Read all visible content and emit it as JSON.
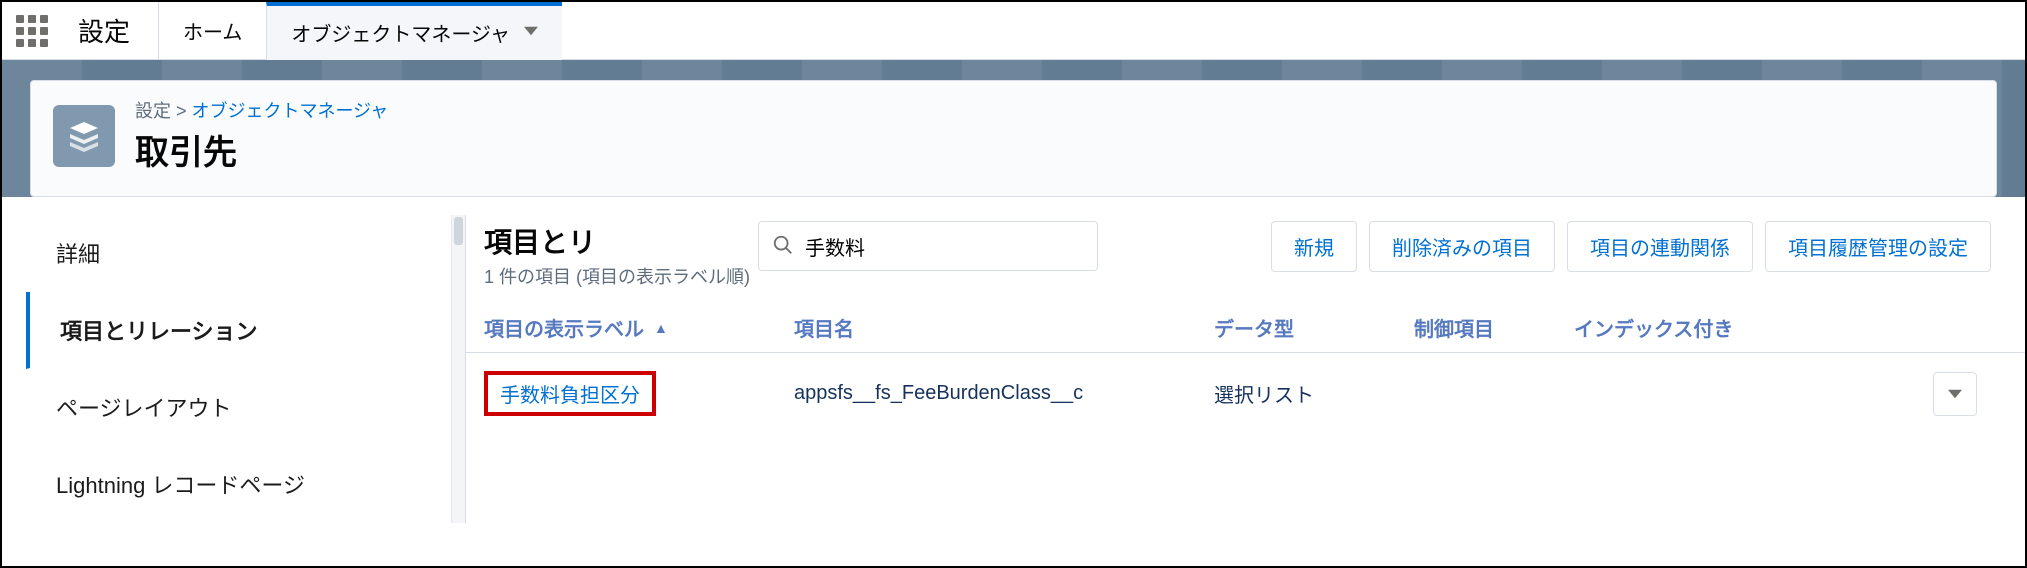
{
  "topbar": {
    "settings_label": "設定",
    "tab_home": "ホーム",
    "tab_object_manager": "オブジェクトマネージャ"
  },
  "breadcrumb": {
    "parent": "設定",
    "current": "オブジェクトマネージャ"
  },
  "object_title": "取引先",
  "sidebar": {
    "items": [
      {
        "label": "詳細"
      },
      {
        "label": "項目とリレーション"
      },
      {
        "label": "ページレイアウト"
      },
      {
        "label": "Lightning レコードページ"
      }
    ]
  },
  "main": {
    "title": "項目とリ",
    "subtitle": "1 件の項目 (項目の表示ラベル順)",
    "search_value": "手数料",
    "actions": {
      "new": "新規",
      "deleted": "削除済みの項目",
      "dependencies": "項目の連動関係",
      "history": "項目履歴管理の設定"
    }
  },
  "table": {
    "columns": {
      "label": "項目の表示ラベル",
      "api": "項目名",
      "type": "データ型",
      "ctrl": "制御項目",
      "idx": "インデックス付き"
    },
    "rows": [
      {
        "label": "手数料負担区分",
        "api": "appsfs__fs_FeeBurdenClass__c",
        "type": "選択リスト",
        "ctrl": "",
        "idx": ""
      }
    ]
  }
}
